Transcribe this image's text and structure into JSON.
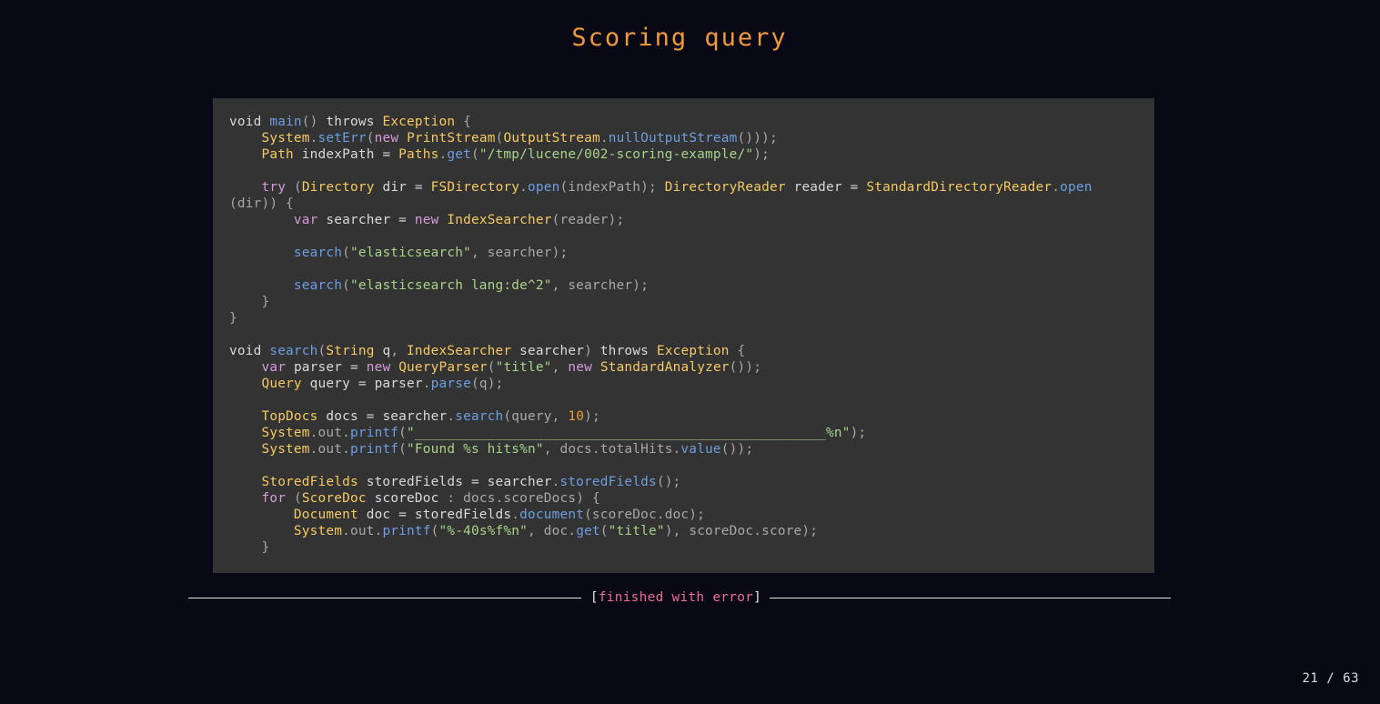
{
  "slide": {
    "title": "Scoring query",
    "status": {
      "open_bracket": "[",
      "label": "finished with error",
      "close_bracket": "]"
    },
    "page_current": "21",
    "page_separator": "/",
    "page_total": "63"
  },
  "code": {
    "lines": [
      [
        [
          "kw",
          "void "
        ],
        [
          "fn",
          "main"
        ],
        [
          "pun",
          "() "
        ],
        [
          "kw",
          "throws "
        ],
        [
          "ty",
          "Exception"
        ],
        [
          "pun",
          " {"
        ]
      ],
      [
        [
          "pun",
          "    "
        ],
        [
          "ty",
          "System"
        ],
        [
          "pun",
          "."
        ],
        [
          "fn",
          "setErr"
        ],
        [
          "pun",
          "("
        ],
        [
          "ctl",
          "new "
        ],
        [
          "ty",
          "PrintStream"
        ],
        [
          "pun",
          "("
        ],
        [
          "ty",
          "OutputStream"
        ],
        [
          "pun",
          "."
        ],
        [
          "fn",
          "nullOutputStream"
        ],
        [
          "pun",
          "()));"
        ]
      ],
      [
        [
          "pun",
          "    "
        ],
        [
          "ty",
          "Path"
        ],
        [
          "kw",
          " indexPath = "
        ],
        [
          "ty",
          "Paths"
        ],
        [
          "pun",
          "."
        ],
        [
          "fn",
          "get"
        ],
        [
          "pun",
          "("
        ],
        [
          "str",
          "\"/tmp/lucene/002-scoring-example/\""
        ],
        [
          "pun",
          ");"
        ]
      ],
      [
        [
          "pun",
          ""
        ]
      ],
      [
        [
          "pun",
          "    "
        ],
        [
          "ctl",
          "try "
        ],
        [
          "pun",
          "("
        ],
        [
          "ty",
          "Directory"
        ],
        [
          "kw",
          " dir = "
        ],
        [
          "ty",
          "FSDirectory"
        ],
        [
          "pun",
          "."
        ],
        [
          "fn",
          "open"
        ],
        [
          "pun",
          "(indexPath); "
        ],
        [
          "ty",
          "DirectoryReader"
        ],
        [
          "kw",
          " reader = "
        ],
        [
          "ty",
          "StandardDirectoryReader"
        ],
        [
          "pun",
          "."
        ],
        [
          "fn",
          "open"
        ]
      ],
      [
        [
          "pun",
          "(dir)) {"
        ]
      ],
      [
        [
          "pun",
          "        "
        ],
        [
          "ctl",
          "var "
        ],
        [
          "kw",
          "searcher = "
        ],
        [
          "ctl",
          "new "
        ],
        [
          "ty",
          "IndexSearcher"
        ],
        [
          "pun",
          "(reader);"
        ]
      ],
      [
        [
          "pun",
          ""
        ]
      ],
      [
        [
          "pun",
          "        "
        ],
        [
          "fn",
          "search"
        ],
        [
          "pun",
          "("
        ],
        [
          "str",
          "\"elasticsearch\""
        ],
        [
          "pun",
          ", searcher);"
        ]
      ],
      [
        [
          "pun",
          ""
        ]
      ],
      [
        [
          "pun",
          "        "
        ],
        [
          "fn",
          "search"
        ],
        [
          "pun",
          "("
        ],
        [
          "str",
          "\"elasticsearch lang:de^2\""
        ],
        [
          "pun",
          ", searcher);"
        ]
      ],
      [
        [
          "pun",
          "    }"
        ]
      ],
      [
        [
          "pun",
          "}"
        ]
      ],
      [
        [
          "pun",
          ""
        ]
      ],
      [
        [
          "kw",
          "void "
        ],
        [
          "fn",
          "search"
        ],
        [
          "pun",
          "("
        ],
        [
          "ty",
          "String"
        ],
        [
          "kw",
          " q"
        ],
        [
          "pun",
          ", "
        ],
        [
          "ty",
          "IndexSearcher"
        ],
        [
          "kw",
          " searcher"
        ],
        [
          "pun",
          ") "
        ],
        [
          "kw",
          "throws "
        ],
        [
          "ty",
          "Exception"
        ],
        [
          "pun",
          " {"
        ]
      ],
      [
        [
          "pun",
          "    "
        ],
        [
          "ctl",
          "var "
        ],
        [
          "kw",
          "parser = "
        ],
        [
          "ctl",
          "new "
        ],
        [
          "ty",
          "QueryParser"
        ],
        [
          "pun",
          "("
        ],
        [
          "str",
          "\"title\""
        ],
        [
          "pun",
          ", "
        ],
        [
          "ctl",
          "new "
        ],
        [
          "ty",
          "StandardAnalyzer"
        ],
        [
          "pun",
          "());"
        ]
      ],
      [
        [
          "pun",
          "    "
        ],
        [
          "ty",
          "Query"
        ],
        [
          "kw",
          " query = parser"
        ],
        [
          "pun",
          "."
        ],
        [
          "fn",
          "parse"
        ],
        [
          "pun",
          "(q);"
        ]
      ],
      [
        [
          "pun",
          ""
        ]
      ],
      [
        [
          "pun",
          "    "
        ],
        [
          "ty",
          "TopDocs"
        ],
        [
          "kw",
          " docs = searcher"
        ],
        [
          "pun",
          "."
        ],
        [
          "fn",
          "search"
        ],
        [
          "pun",
          "(query, "
        ],
        [
          "num",
          "10"
        ],
        [
          "pun",
          ");"
        ]
      ],
      [
        [
          "pun",
          "    "
        ],
        [
          "ty",
          "System"
        ],
        [
          "pun",
          ".out."
        ],
        [
          "fn",
          "printf"
        ],
        [
          "pun",
          "("
        ],
        [
          "str",
          "\"___________________________________________________%n\""
        ],
        [
          "pun",
          ");"
        ]
      ],
      [
        [
          "pun",
          "    "
        ],
        [
          "ty",
          "System"
        ],
        [
          "pun",
          ".out."
        ],
        [
          "fn",
          "printf"
        ],
        [
          "pun",
          "("
        ],
        [
          "str",
          "\"Found %s hits%n\""
        ],
        [
          "pun",
          ", docs.totalHits."
        ],
        [
          "fn",
          "value"
        ],
        [
          "pun",
          "());"
        ]
      ],
      [
        [
          "pun",
          ""
        ]
      ],
      [
        [
          "pun",
          "    "
        ],
        [
          "ty",
          "StoredFields"
        ],
        [
          "kw",
          " storedFields = searcher"
        ],
        [
          "pun",
          "."
        ],
        [
          "fn",
          "storedFields"
        ],
        [
          "pun",
          "();"
        ]
      ],
      [
        [
          "pun",
          "    "
        ],
        [
          "ctl",
          "for "
        ],
        [
          "pun",
          "("
        ],
        [
          "ty",
          "ScoreDoc"
        ],
        [
          "kw",
          " scoreDoc "
        ],
        [
          "pun",
          ": docs.scoreDocs) {"
        ]
      ],
      [
        [
          "pun",
          "        "
        ],
        [
          "ty",
          "Document"
        ],
        [
          "kw",
          " doc = storedFields"
        ],
        [
          "pun",
          "."
        ],
        [
          "fn",
          "document"
        ],
        [
          "pun",
          "(scoreDoc.doc);"
        ]
      ],
      [
        [
          "pun",
          "        "
        ],
        [
          "ty",
          "System"
        ],
        [
          "pun",
          ".out."
        ],
        [
          "fn",
          "printf"
        ],
        [
          "pun",
          "("
        ],
        [
          "str",
          "\"%-40s%f%n\""
        ],
        [
          "pun",
          ", doc."
        ],
        [
          "fn",
          "get"
        ],
        [
          "pun",
          "("
        ],
        [
          "str",
          "\"title\""
        ],
        [
          "pun",
          "), scoreDoc.score);"
        ]
      ],
      [
        [
          "pun",
          "    }"
        ]
      ]
    ]
  }
}
